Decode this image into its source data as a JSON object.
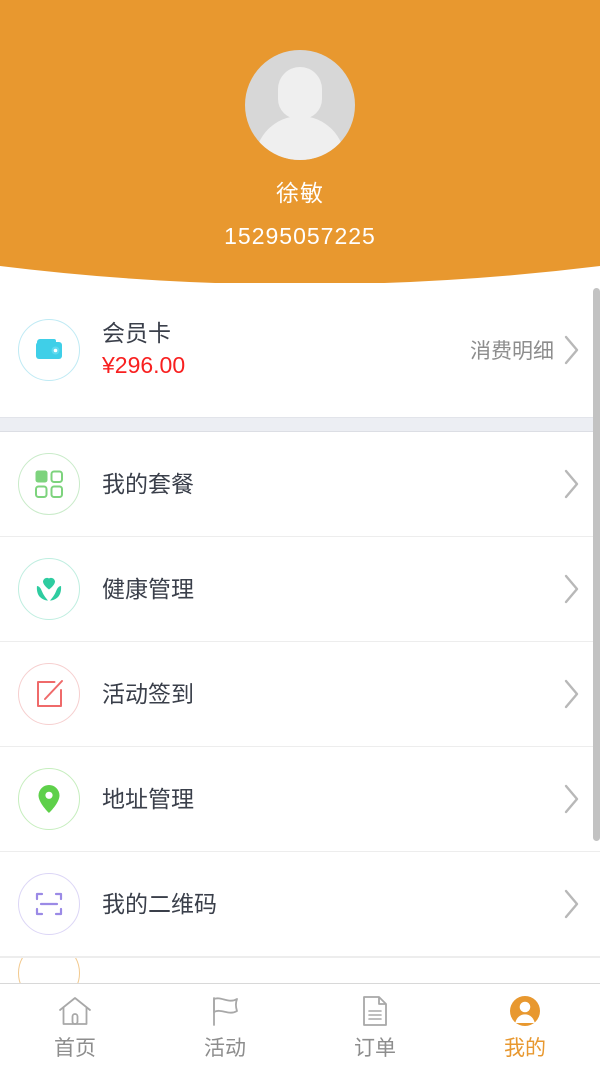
{
  "theme": {
    "brand_orange": "#e8982f",
    "amount_red": "#f82020",
    "title_gray": "#3a3f4a",
    "muted_gray": "#8d8d8d",
    "divider": "#ededed",
    "band": "#eceef3"
  },
  "header": {
    "avatar_icon": "default-user-avatar-icon",
    "user_name": "徐敏",
    "user_phone": "15295057225"
  },
  "membership": {
    "icon": "wallet-icon",
    "icon_color": "#3fcfe8",
    "title": "会员卡",
    "amount": "¥296.00",
    "link_label": "消费明细",
    "chevron_icon": "chevron-right-icon"
  },
  "menu": [
    {
      "id": "my-package",
      "label": "我的套餐",
      "icon": "grid-squares-icon",
      "icon_color": "#7dd37d",
      "chevron_icon": "chevron-right-icon"
    },
    {
      "id": "health-management",
      "label": "健康管理",
      "icon": "heart-in-hands-icon",
      "icon_color": "#2ecca0",
      "chevron_icon": "chevron-right-icon"
    },
    {
      "id": "activity-checkin",
      "label": "活动签到",
      "icon": "edit-square-icon",
      "icon_color": "#ef6a6a",
      "chevron_icon": "chevron-right-icon"
    },
    {
      "id": "address-management",
      "label": "地址管理",
      "icon": "location-pin-icon",
      "icon_color": "#5ed04a",
      "chevron_icon": "chevron-right-icon"
    },
    {
      "id": "my-qr-code",
      "label": "我的二维码",
      "icon": "qr-scan-frame-icon",
      "icon_color": "#9b8ae6",
      "chevron_icon": "chevron-right-icon"
    }
  ],
  "clipped_row": {
    "icon": "partially-visible-icon",
    "icon_color": "#e8982f"
  },
  "scrollbar": {
    "name": "vertical-scrollbar"
  },
  "tabbar": [
    {
      "id": "home",
      "label": "首页",
      "icon": "home-icon",
      "active": false
    },
    {
      "id": "activity",
      "label": "活动",
      "icon": "flag-icon",
      "active": false
    },
    {
      "id": "orders",
      "label": "订单",
      "icon": "document-icon",
      "active": false
    },
    {
      "id": "mine",
      "label": "我的",
      "icon": "person-icon",
      "active": true
    }
  ]
}
